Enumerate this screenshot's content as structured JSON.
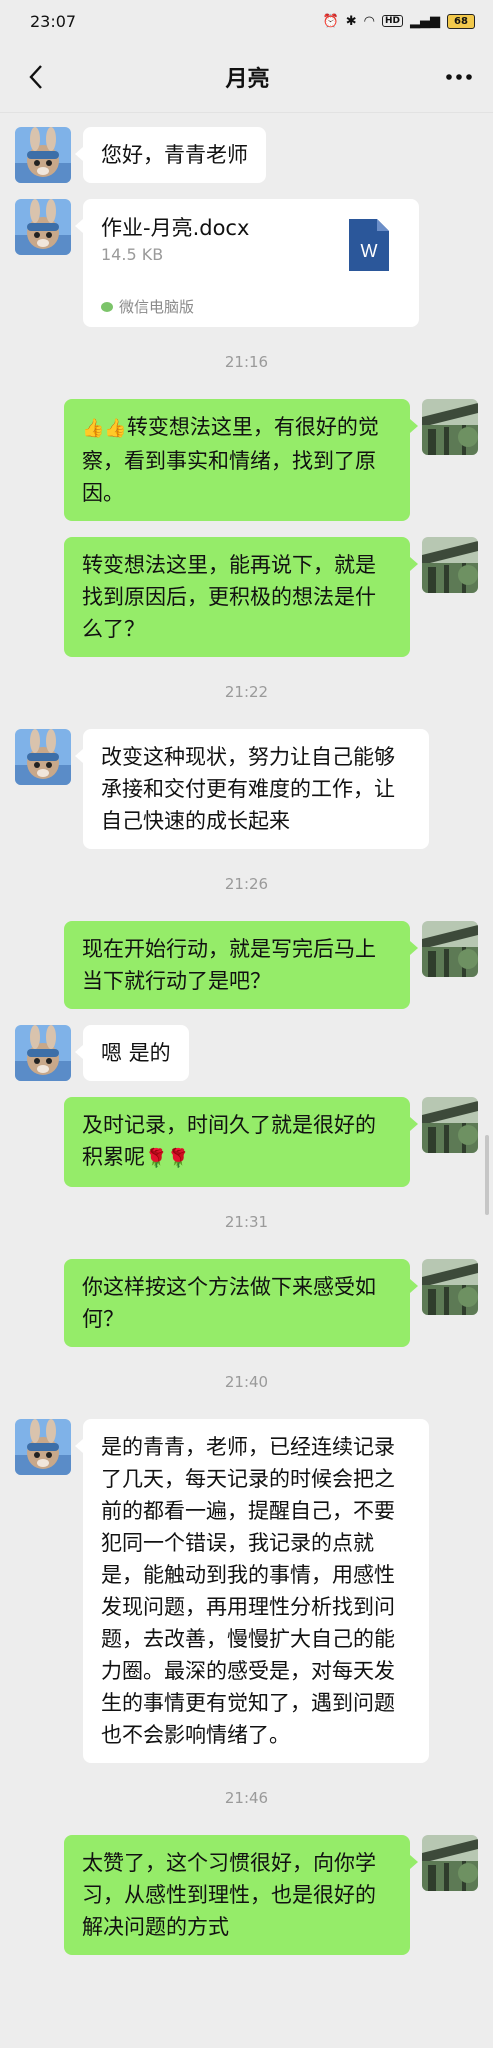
{
  "status": {
    "time": "23:07",
    "battery": "68"
  },
  "header": {
    "title": "月亮"
  },
  "file": {
    "name": "作业-月亮.docx",
    "size": "14.5 KB",
    "source": "微信电脑版",
    "icon_letter": "W"
  },
  "messages": {
    "m1": "您好，青青老师",
    "t1": "21:16",
    "m2_prefix": "👍👍",
    "m2_text": "转变想法这里，有很好的觉察，看到事实和情绪，找到了原因。",
    "m3": "转变想法这里，能再说下，就是找到原因后，更积极的想法是什么了？",
    "t2": "21:22",
    "m4": "改变这种现状，努力让自己能够承接和交付更有难度的工作，让自己快速的成长起来",
    "t3": "21:26",
    "m5": "现在开始行动，就是写完后马上当下就行动了是吧？",
    "m6": "嗯 是的",
    "m7_text": "及时记录，时间久了就是很好的积累呢",
    "m7_suffix": "🌹🌹",
    "t4": "21:31",
    "m8": "你这样按这个方法做下来感受如何？",
    "t5": "21:40",
    "m9": "是的青青，老师，已经连续记录了几天，每天记录的时候会把之前的都看一遍，提醒自己，不要犯同一个错误，我记录的点就是，能触动到我的事情，用感性发现问题，再用理性分析找到问题，去改善，慢慢扩大自己的能力圈。最深的感受是，对每天发生的事情更有觉知了，遇到问题也不会影响情绪了。",
    "t6": "21:46",
    "m10": "太赞了，这个习惯很好，向你学习，从感性到理性，也是很好的解决问题的方式"
  }
}
